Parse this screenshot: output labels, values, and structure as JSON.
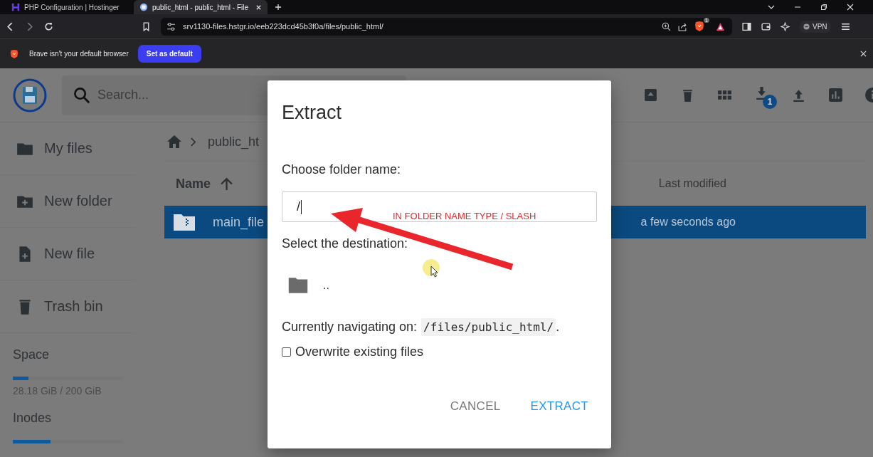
{
  "browser": {
    "tabs": [
      {
        "title": "PHP Configuration | Hostinger",
        "selected": false
      },
      {
        "title": "public_html - public_html - File",
        "selected": true
      }
    ],
    "url": "srv1130-files.hstgr.io/eeb223dcd45b3f0a/files/public_html/",
    "shield_count": "1",
    "vpn": "VPN",
    "infobar": {
      "message": "Brave isn't your default browser",
      "button": "Set as default"
    }
  },
  "app": {
    "search": {
      "placeholder": "Search..."
    },
    "download_badge": "1",
    "sidebar": [
      {
        "label": "My files"
      },
      {
        "label": "New folder"
      },
      {
        "label": "New file"
      },
      {
        "label": "Trash bin"
      }
    ],
    "usage": [
      {
        "label": "Space",
        "level": 0.14,
        "reading": "28.18 GiB / 200 GiB"
      },
      {
        "label": "Inodes",
        "level": 0.34
      }
    ],
    "breadcrumb": "public_ht",
    "columns": {
      "name": "Name",
      "modified": "Last modified"
    },
    "rows": [
      {
        "name": "main_file",
        "modified": "a few seconds ago",
        "selected": true
      }
    ]
  },
  "dialog": {
    "title": "Extract",
    "folder_label": "Choose folder name:",
    "folder_value": "/",
    "destination_label": "Select the destination:",
    "destinations": [
      ".."
    ],
    "navigating_label": "Currently navigating on:",
    "path": "/files/public_html/",
    "path_end": ".",
    "overwrite": {
      "label": "Overwrite existing files",
      "checked": false
    },
    "buttons": [
      "CANCEL",
      "EXTRACT"
    ]
  },
  "annotation": "IN FOLDER NAME TYPE / SLASH"
}
